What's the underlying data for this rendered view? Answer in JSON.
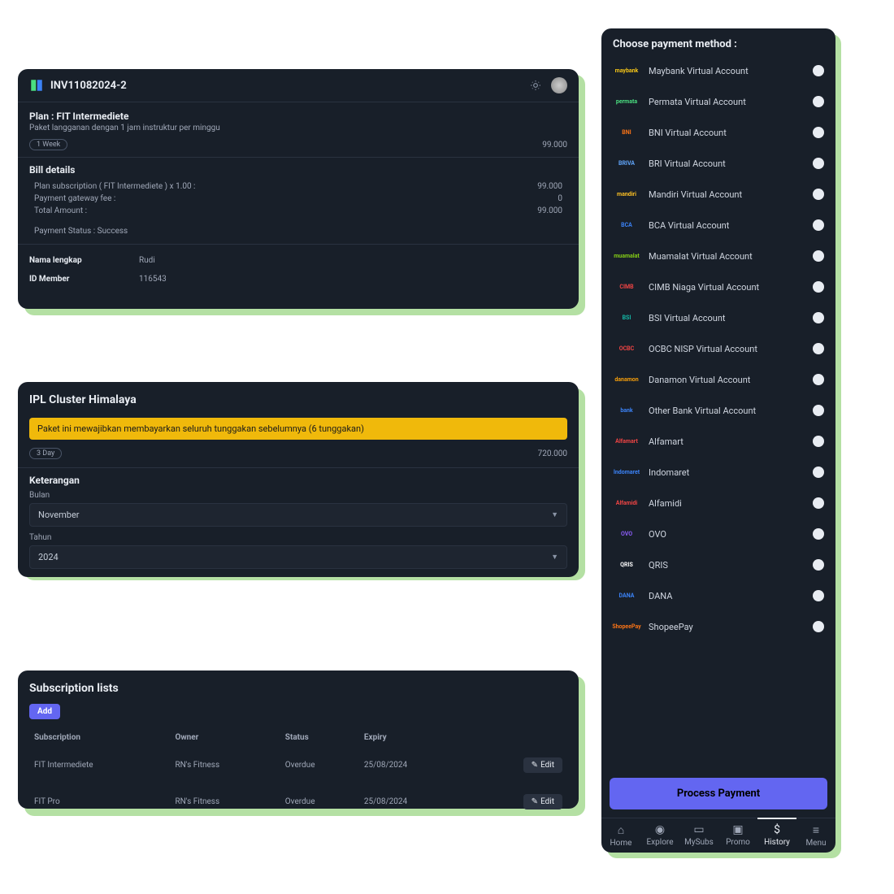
{
  "invoice": {
    "number": "INV11082024-2",
    "plan_title": "Plan : FIT Intermediete",
    "plan_desc": "Paket langganan dengan 1 jam instruktur per minggu",
    "duration": "1 Week",
    "amount": "99.000",
    "bill_title": "Bill details",
    "line1_label": "Plan subscription ( FIT Intermediete ) x 1.00 :",
    "line1_val": "99.000",
    "line2_label": "Payment gateway fee :",
    "line2_val": "0",
    "line3_label": "Total Amount :",
    "line3_val": "99.000",
    "status": "Payment Status : Success",
    "name_label": "Nama lengkap",
    "name_val": "Rudi",
    "id_label": "ID Member",
    "id_val": "116543"
  },
  "ipl": {
    "title": "IPL Cluster Himalaya",
    "alert": "Paket ini mewajibkan membayarkan seluruh tunggakan sebelumnya (6 tunggakan)",
    "duration": "3 Day",
    "amount": "720.000",
    "section": "Keterangan",
    "month_label": "Bulan",
    "month_val": "November",
    "year_label": "Tahun",
    "year_val": "2024"
  },
  "subs": {
    "title": "Subscription lists",
    "add": "Add",
    "cols": {
      "sub": "Subscription",
      "owner": "Owner",
      "status": "Status",
      "expiry": "Expiry"
    },
    "rows": [
      {
        "sub": "FIT Intermediete",
        "owner": "RN's Fitness",
        "status": "Overdue",
        "expiry": "25/08/2024"
      },
      {
        "sub": "FIT Pro",
        "owner": "RN's Fitness",
        "status": "Overdue",
        "expiry": "25/08/2024"
      }
    ],
    "edit": "Edit"
  },
  "payment": {
    "title": "Choose payment method :",
    "methods": [
      {
        "name": "Maybank Virtual Account",
        "logo": "maybank",
        "color": "#f5c518"
      },
      {
        "name": "Permata Virtual Account",
        "logo": "permata",
        "color": "#4ade80"
      },
      {
        "name": "BNI Virtual Account",
        "logo": "BNI",
        "color": "#f97316"
      },
      {
        "name": "BRI Virtual Account",
        "logo": "BRIVA",
        "color": "#60a5fa"
      },
      {
        "name": "Mandiri Virtual Account",
        "logo": "mandiri",
        "color": "#fbbf24"
      },
      {
        "name": "BCA Virtual Account",
        "logo": "BCA",
        "color": "#3b82f6"
      },
      {
        "name": "Muamalat Virtual Account",
        "logo": "muamalat",
        "color": "#84cc16"
      },
      {
        "name": "CIMB Niaga Virtual Account",
        "logo": "CIMB",
        "color": "#ef4444"
      },
      {
        "name": "BSI Virtual Account",
        "logo": "BSI",
        "color": "#14b8a6"
      },
      {
        "name": "OCBC NISP Virtual Account",
        "logo": "OCBC",
        "color": "#ef4444"
      },
      {
        "name": "Danamon Virtual Account",
        "logo": "danamon",
        "color": "#f59e0b"
      },
      {
        "name": "Other Bank Virtual Account",
        "logo": "bank",
        "color": "#3b82f6"
      },
      {
        "name": "Alfamart",
        "logo": "Alfamart",
        "color": "#ef4444"
      },
      {
        "name": "Indomaret",
        "logo": "Indomaret",
        "color": "#3b82f6"
      },
      {
        "name": "Alfamidi",
        "logo": "Alfamidi",
        "color": "#ef4444"
      },
      {
        "name": "OVO",
        "logo": "OVO",
        "color": "#8b5cf6"
      },
      {
        "name": "QRIS",
        "logo": "QRIS",
        "color": "#fff"
      },
      {
        "name": "DANA",
        "logo": "DANA",
        "color": "#3b82f6"
      },
      {
        "name": "ShopeePay",
        "logo": "ShopeePay",
        "color": "#f97316"
      }
    ],
    "process": "Process Payment",
    "nav": [
      {
        "label": "Home",
        "icon": "⌂"
      },
      {
        "label": "Explore",
        "icon": "◉"
      },
      {
        "label": "MySubs",
        "icon": "▭"
      },
      {
        "label": "Promo",
        "icon": "▣"
      },
      {
        "label": "History",
        "icon": "$",
        "active": true
      },
      {
        "label": "Menu",
        "icon": "≡"
      }
    ]
  }
}
